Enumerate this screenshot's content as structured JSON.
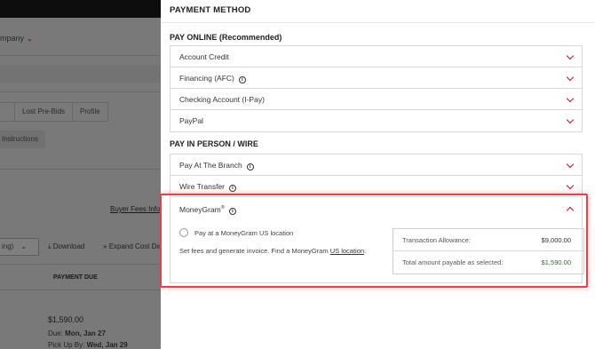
{
  "background": {
    "company_label": "mpany",
    "tabs": [
      "",
      "Lost Pre-Bids",
      "Profile"
    ],
    "instructions_label": "Instructions",
    "buyer_fees_link": "Buyer Fees Inform",
    "filter_value": "ing)",
    "download_label": "Download",
    "expand_label": "Expand Cost De",
    "payment_due_header": "PAYMENT DUE",
    "amount": "$1,590.00",
    "due_prefix": "Due:",
    "due_value": "Mon, Jan 27",
    "pickup_prefix": "Pick Up By:",
    "pickup_value": "Wed, Jan 29"
  },
  "panel": {
    "title": "PAYMENT METHOD",
    "pay_online": {
      "title": "PAY ONLINE (Recommended)",
      "options": [
        {
          "label": "Account Credit",
          "info": false
        },
        {
          "label": "Financing (AFC)",
          "info": true
        },
        {
          "label": "Checking Account (I-Pay)",
          "info": false
        },
        {
          "label": "PayPal",
          "info": false
        }
      ]
    },
    "pay_in_person": {
      "title": "PAY IN PERSON / WIRE",
      "options": [
        {
          "label": "Pay At The Branch",
          "info": true
        },
        {
          "label": "Wire Transfer",
          "info": true
        }
      ]
    },
    "moneygram": {
      "label": "MoneyGram",
      "trademark": "®",
      "radio_label": "Pay at a MoneyGram US location",
      "description_prefix": "Set fees and generate invoice. Find a MoneyGram",
      "description_link": "US location",
      "description_suffix": ".",
      "summary": [
        {
          "label": "Transaction Allowance:",
          "value": "$9,000.00",
          "color": "#333333"
        },
        {
          "label": "Total amount payable as selected:",
          "value": "$1,590.00",
          "color": "#1a7d23"
        }
      ]
    }
  },
  "colors": {
    "accent_red": "#c8102e",
    "highlight_red": "#e0454d",
    "positive_green": "#1a7d23"
  },
  "icons": {
    "info": "info-icon",
    "chevron_down": "chevron-down-icon",
    "chevron_up": "chevron-up-icon",
    "download": "download-icon",
    "expand": "expand-icon"
  }
}
